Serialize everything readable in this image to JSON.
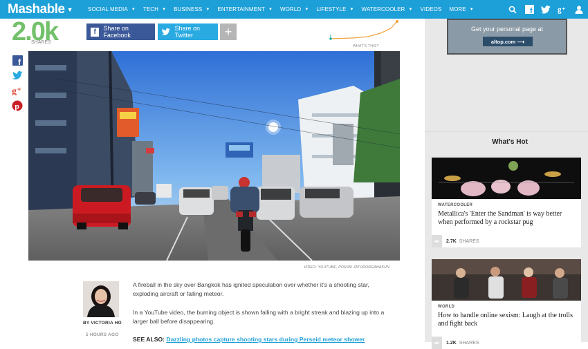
{
  "nav": {
    "logo": "Mashable",
    "items": [
      {
        "label": "SOCIAL MEDIA",
        "caret": true
      },
      {
        "label": "TECH",
        "caret": true
      },
      {
        "label": "BUSINESS",
        "caret": true
      },
      {
        "label": "ENTERTAINMENT",
        "caret": true
      },
      {
        "label": "WORLD",
        "caret": true
      },
      {
        "label": "LIFESTYLE",
        "caret": true
      },
      {
        "label": "WATERCOOLER",
        "caret": true
      },
      {
        "label": "VIDEOS",
        "caret": false
      },
      {
        "label": "MORE",
        "caret": true
      }
    ],
    "right_icons": [
      "search-icon",
      "facebook-icon",
      "twitter-icon",
      "google-plus-icon",
      "user-icon"
    ]
  },
  "share": {
    "count": "2.0k",
    "count_label": "SHARES",
    "facebook_label": "Share on Facebook",
    "twitter_label": "Share on Twitter",
    "more_label": "+",
    "whats_this": "WHAT'S THIS?"
  },
  "video": {
    "caption": "VIDEO: YOUTUBE, PORJAI JATURONGAHAKUN"
  },
  "author": {
    "byline": "BY VICTORIA HO",
    "time": "5 HOURS AGO"
  },
  "article": {
    "p1": "A fireball in the sky over Bangkok has ignited speculation over whether it's a shooting star, exploding aircraft or falling meteor.",
    "p2": "In a YouTube video, the burning object is shown falling with a bright streak and blazing up into a larger ball before disappearing.",
    "see_also_label": "SEE ALSO:",
    "see_also_link": "Dazzling photos capture shooting stars during Perseid meteor shower"
  },
  "sidebar": {
    "ad_text": "Get your personal page at",
    "ad_button": "altop.com  ⟶",
    "whats_hot": "What's Hot",
    "cards": [
      {
        "category": "WATERCOOLER",
        "title": "Metallica's 'Enter the Sandman' is way better when performed by a rockstar pug",
        "shares": "2.7K",
        "shares_label": "SHARES"
      },
      {
        "category": "WORLD",
        "title": "How to handle online sexism: Laugh at the trolls and fight back",
        "shares": "1.2K",
        "shares_label": "SHARES"
      }
    ]
  },
  "colors": {
    "nav_bg": "#1d9fd8",
    "share_green": "#73c16b",
    "facebook": "#3b5998",
    "twitter": "#29aae1"
  }
}
